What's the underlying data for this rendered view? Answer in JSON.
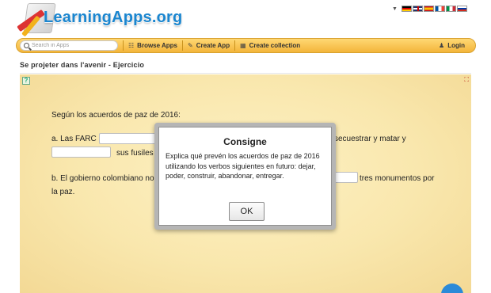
{
  "header": {
    "logo_text": "LearningApps.org",
    "languages": [
      "de",
      "en",
      "es",
      "fr",
      "it",
      "ru"
    ],
    "language_dropdown_icon": "triangle-down-icon"
  },
  "toolbar": {
    "search_placeholder": "Search in Apps",
    "browse_label": "Browse Apps",
    "create_label": "Create App",
    "collection_label": "Create collection",
    "login_label": "Login",
    "accent_color": "#f3b53a"
  },
  "page": {
    "title": "Se projeter dans l'avenir - Ejercicio"
  },
  "exercise": {
    "intro": "Según los acuerdos de paz de 2016:",
    "line_a_prefix": "a. Las FARC",
    "line_a_suffix": "secuestrar y matar y",
    "line_a2_suffix": "sus fusiles",
    "line_b_prefix": "b. El gobierno colombiano no",
    "line_b_suffix": "tres monumentos por",
    "line_b2": "la paz."
  },
  "modal": {
    "title": "Consigne",
    "body": "Explica qué prevén los acuerdos de paz de 2016 utilizando los verbos siguientes en futuro: dejar, poder, construir, abandonar, entregar.",
    "ok_label": "OK"
  }
}
